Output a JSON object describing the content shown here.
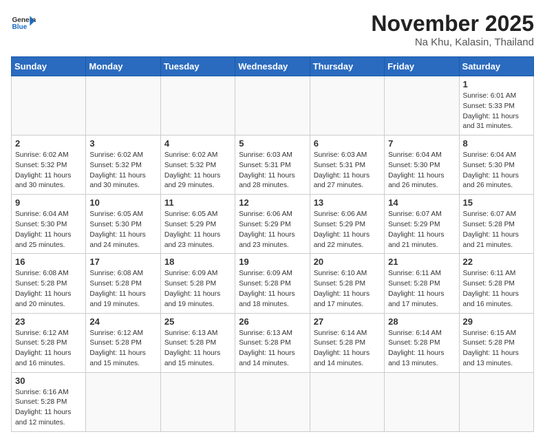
{
  "logo": {
    "text_general": "General",
    "text_blue": "Blue"
  },
  "title": "November 2025",
  "location": "Na Khu, Kalasin, Thailand",
  "days_of_week": [
    "Sunday",
    "Monday",
    "Tuesday",
    "Wednesday",
    "Thursday",
    "Friday",
    "Saturday"
  ],
  "weeks": [
    [
      {
        "day": "",
        "info": ""
      },
      {
        "day": "",
        "info": ""
      },
      {
        "day": "",
        "info": ""
      },
      {
        "day": "",
        "info": ""
      },
      {
        "day": "",
        "info": ""
      },
      {
        "day": "",
        "info": ""
      },
      {
        "day": "1",
        "info": "Sunrise: 6:01 AM\nSunset: 5:33 PM\nDaylight: 11 hours\nand 31 minutes."
      }
    ],
    [
      {
        "day": "2",
        "info": "Sunrise: 6:02 AM\nSunset: 5:32 PM\nDaylight: 11 hours\nand 30 minutes."
      },
      {
        "day": "3",
        "info": "Sunrise: 6:02 AM\nSunset: 5:32 PM\nDaylight: 11 hours\nand 30 minutes."
      },
      {
        "day": "4",
        "info": "Sunrise: 6:02 AM\nSunset: 5:32 PM\nDaylight: 11 hours\nand 29 minutes."
      },
      {
        "day": "5",
        "info": "Sunrise: 6:03 AM\nSunset: 5:31 PM\nDaylight: 11 hours\nand 28 minutes."
      },
      {
        "day": "6",
        "info": "Sunrise: 6:03 AM\nSunset: 5:31 PM\nDaylight: 11 hours\nand 27 minutes."
      },
      {
        "day": "7",
        "info": "Sunrise: 6:04 AM\nSunset: 5:30 PM\nDaylight: 11 hours\nand 26 minutes."
      },
      {
        "day": "8",
        "info": "Sunrise: 6:04 AM\nSunset: 5:30 PM\nDaylight: 11 hours\nand 26 minutes."
      }
    ],
    [
      {
        "day": "9",
        "info": "Sunrise: 6:04 AM\nSunset: 5:30 PM\nDaylight: 11 hours\nand 25 minutes."
      },
      {
        "day": "10",
        "info": "Sunrise: 6:05 AM\nSunset: 5:30 PM\nDaylight: 11 hours\nand 24 minutes."
      },
      {
        "day": "11",
        "info": "Sunrise: 6:05 AM\nSunset: 5:29 PM\nDaylight: 11 hours\nand 23 minutes."
      },
      {
        "day": "12",
        "info": "Sunrise: 6:06 AM\nSunset: 5:29 PM\nDaylight: 11 hours\nand 23 minutes."
      },
      {
        "day": "13",
        "info": "Sunrise: 6:06 AM\nSunset: 5:29 PM\nDaylight: 11 hours\nand 22 minutes."
      },
      {
        "day": "14",
        "info": "Sunrise: 6:07 AM\nSunset: 5:29 PM\nDaylight: 11 hours\nand 21 minutes."
      },
      {
        "day": "15",
        "info": "Sunrise: 6:07 AM\nSunset: 5:28 PM\nDaylight: 11 hours\nand 21 minutes."
      }
    ],
    [
      {
        "day": "16",
        "info": "Sunrise: 6:08 AM\nSunset: 5:28 PM\nDaylight: 11 hours\nand 20 minutes."
      },
      {
        "day": "17",
        "info": "Sunrise: 6:08 AM\nSunset: 5:28 PM\nDaylight: 11 hours\nand 19 minutes."
      },
      {
        "day": "18",
        "info": "Sunrise: 6:09 AM\nSunset: 5:28 PM\nDaylight: 11 hours\nand 19 minutes."
      },
      {
        "day": "19",
        "info": "Sunrise: 6:09 AM\nSunset: 5:28 PM\nDaylight: 11 hours\nand 18 minutes."
      },
      {
        "day": "20",
        "info": "Sunrise: 6:10 AM\nSunset: 5:28 PM\nDaylight: 11 hours\nand 17 minutes."
      },
      {
        "day": "21",
        "info": "Sunrise: 6:11 AM\nSunset: 5:28 PM\nDaylight: 11 hours\nand 17 minutes."
      },
      {
        "day": "22",
        "info": "Sunrise: 6:11 AM\nSunset: 5:28 PM\nDaylight: 11 hours\nand 16 minutes."
      }
    ],
    [
      {
        "day": "23",
        "info": "Sunrise: 6:12 AM\nSunset: 5:28 PM\nDaylight: 11 hours\nand 16 minutes."
      },
      {
        "day": "24",
        "info": "Sunrise: 6:12 AM\nSunset: 5:28 PM\nDaylight: 11 hours\nand 15 minutes."
      },
      {
        "day": "25",
        "info": "Sunrise: 6:13 AM\nSunset: 5:28 PM\nDaylight: 11 hours\nand 15 minutes."
      },
      {
        "day": "26",
        "info": "Sunrise: 6:13 AM\nSunset: 5:28 PM\nDaylight: 11 hours\nand 14 minutes."
      },
      {
        "day": "27",
        "info": "Sunrise: 6:14 AM\nSunset: 5:28 PM\nDaylight: 11 hours\nand 14 minutes."
      },
      {
        "day": "28",
        "info": "Sunrise: 6:14 AM\nSunset: 5:28 PM\nDaylight: 11 hours\nand 13 minutes."
      },
      {
        "day": "29",
        "info": "Sunrise: 6:15 AM\nSunset: 5:28 PM\nDaylight: 11 hours\nand 13 minutes."
      }
    ],
    [
      {
        "day": "30",
        "info": "Sunrise: 6:16 AM\nSunset: 5:28 PM\nDaylight: 11 hours\nand 12 minutes."
      },
      {
        "day": "",
        "info": ""
      },
      {
        "day": "",
        "info": ""
      },
      {
        "day": "",
        "info": ""
      },
      {
        "day": "",
        "info": ""
      },
      {
        "day": "",
        "info": ""
      },
      {
        "day": "",
        "info": ""
      }
    ]
  ]
}
